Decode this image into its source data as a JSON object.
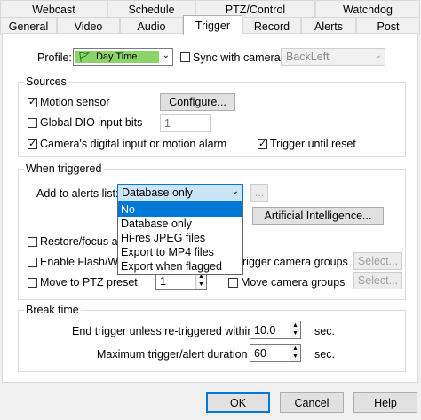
{
  "tabs_top": [
    "Webcast",
    "Schedule",
    "PTZ/Control",
    "Watchdog"
  ],
  "tabs_bottom": [
    "General",
    "Video",
    "Audio",
    "Trigger",
    "Record",
    "Alerts",
    "Post"
  ],
  "active_tab": "Trigger",
  "profile": {
    "label": "Profile:",
    "value": "Day Time",
    "sync_label": "Sync with camera",
    "sync_checked": false,
    "camera_value": "BackLeft"
  },
  "sources": {
    "title": "Sources",
    "motion_label": "Motion sensor",
    "configure_button": "Configure...",
    "dio_label": "Global DIO input bits",
    "dio_value": "1",
    "camera_input_label": "Camera's digital input or motion alarm",
    "until_reset_label": "Trigger until reset"
  },
  "when_triggered": {
    "title": "When triggered",
    "add_alerts_label": "Add to alerts list:",
    "add_alerts_value": "Database only",
    "more_button": "...",
    "ai_button": "Artificial Intelligence...",
    "dropdown_options": [
      "No",
      "Database only",
      "Hi-res JPEG files",
      "Export to MP4 files",
      "Export when flagged"
    ],
    "restore_label": "Restore/focus app",
    "flash_label": "Enable Flash/WM",
    "trigger_groups_label": "rigger camera groups",
    "select_button_1": "Select...",
    "ptz_label": "Move to PTZ preset",
    "ptz_value": "1",
    "move_groups_label": "Move camera groups",
    "select_button_2": "Select..."
  },
  "break_time": {
    "title": "Break time",
    "end_label": "End trigger unless re-triggered within",
    "end_value": "10.0",
    "end_unit": "sec.",
    "max_label": "Maximum trigger/alert duration",
    "max_value": "60",
    "max_unit": "sec."
  },
  "footer": {
    "ok": "OK",
    "cancel": "Cancel",
    "help": "Help"
  }
}
